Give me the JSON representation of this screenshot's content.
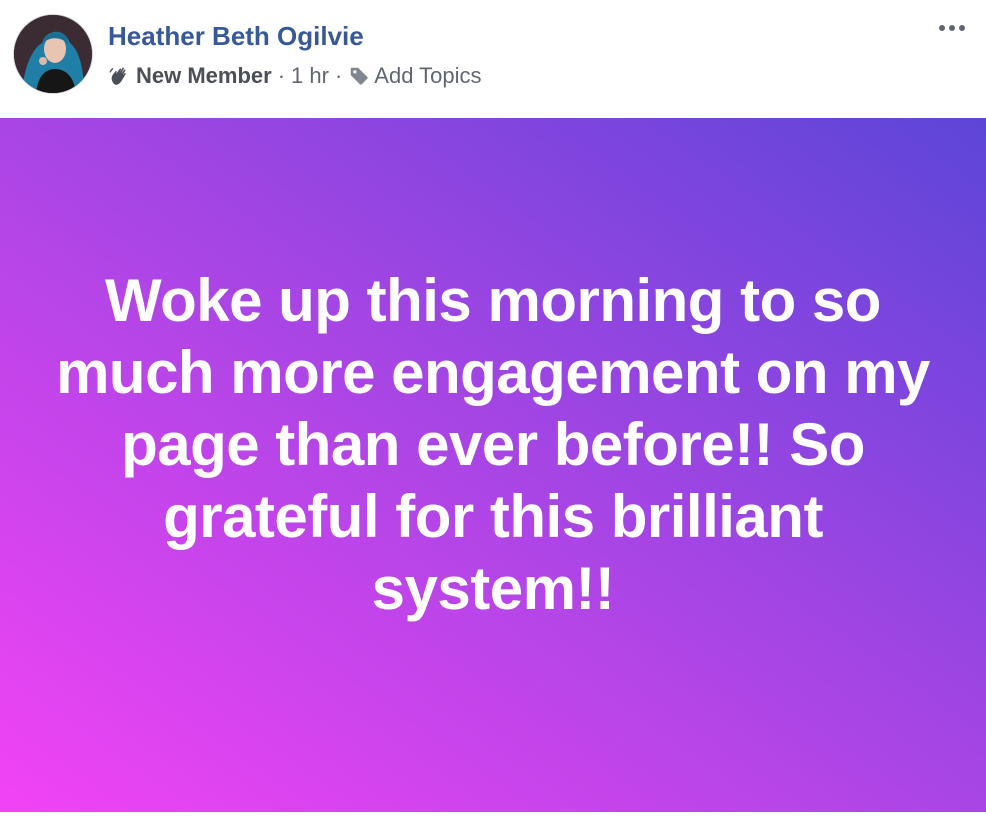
{
  "post": {
    "author": {
      "name": "Heather Beth Ogilvie",
      "avatar_icon": "profile-photo"
    },
    "meta": {
      "badge_icon": "waving-hand-icon",
      "badge_label": "New Member",
      "separator": "·",
      "time": "1 hr",
      "topics_icon": "tag-icon",
      "topics_label": "Add Topics"
    },
    "more_icon": "more-options-icon",
    "body": {
      "text": "Woke up this morning to so much more engagement on my page than ever before!! So grateful for this brilliant system!!",
      "background_colors": [
        "#f243f5",
        "#b145e6",
        "#8a45e0",
        "#5d45d8"
      ],
      "text_color": "#ffffff"
    }
  },
  "colors": {
    "author_name": "#385898",
    "meta_text": "#606770"
  }
}
